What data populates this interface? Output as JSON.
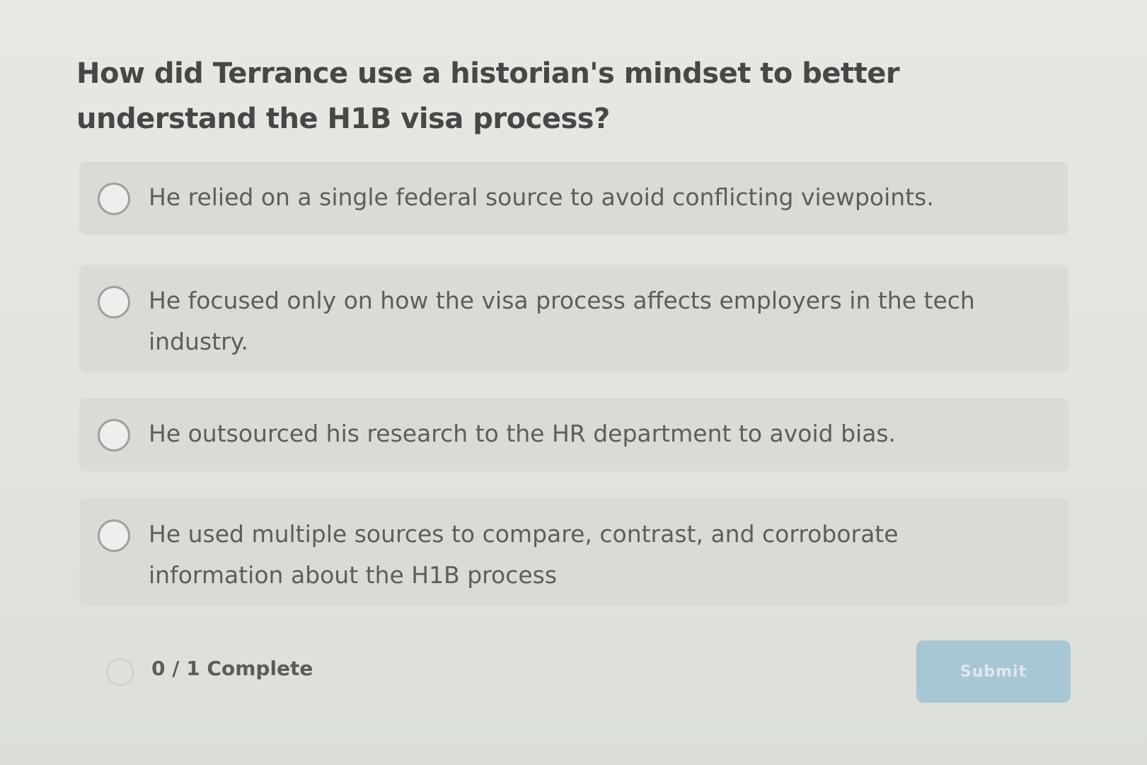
{
  "question": {
    "text": "How did Terrance use a historian's mindset to better understand the H1B visa process?"
  },
  "options": [
    {
      "label": "He relied on a single federal source to avoid conflicting viewpoints."
    },
    {
      "label": "He focused only on how the visa process affects employers in the tech industry."
    },
    {
      "label": "He outsourced his research to the HR department to avoid bias."
    },
    {
      "label": "He used multiple sources to compare, contrast, and corroborate information about the H1B process"
    }
  ],
  "footer": {
    "progress": "0 / 1 Complete",
    "submit_label": "Submit"
  },
  "colors": {
    "background": "#e3e5e0",
    "option_background": "#d9dbd6",
    "button": "#a8c6d3"
  }
}
